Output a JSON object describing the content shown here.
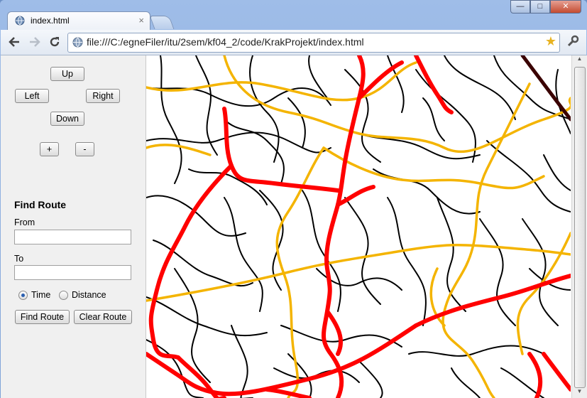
{
  "browser": {
    "tab_title": "index.html",
    "tab_close": "×",
    "window_controls": {
      "minimize": "—",
      "maximize": "□",
      "close": "✕"
    },
    "url": "file:///C:/egneFiler/itu/2sem/kf04_2/code/KrakProjekt/index.html",
    "icons": [
      "back-arrow-icon",
      "forward-arrow-icon",
      "reload-icon",
      "page-icon",
      "bookmark-star-icon",
      "wrench-icon"
    ]
  },
  "navigation": {
    "up": "Up",
    "left": "Left",
    "right": "Right",
    "down": "Down",
    "zoom_in": "+",
    "zoom_out": "-"
  },
  "route": {
    "heading": "Find Route",
    "from_label": "From",
    "from_value": "",
    "to_label": "To",
    "to_value": "",
    "mode_options": [
      "Time",
      "Distance"
    ],
    "selected_mode": "Time",
    "find_button": "Find Route",
    "clear_button": "Clear Route"
  },
  "map": {
    "road_colors": {
      "minor": "#000000",
      "primary": "#f0b400",
      "highway": "#ff0000",
      "special": "#3a0000"
    }
  }
}
